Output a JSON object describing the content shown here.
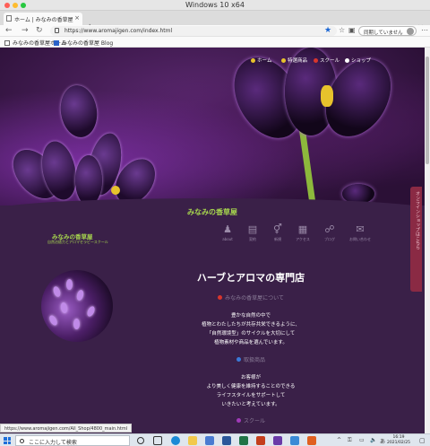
{
  "window": {
    "title": "Windows 10 x64"
  },
  "browser": {
    "tab_title": "ホーム | みなみの香草屋",
    "tab_close": "×",
    "new_tab": "+",
    "window_controls": [
      "—",
      "▢",
      "✕"
    ],
    "url": "https://www.aromajigen.com/index.html",
    "sync_label": "同期していません",
    "bookmarks": [
      {
        "label": "みなみの香草屋ホーム",
        "icon": "page-icon"
      },
      {
        "label": "みなみの香草屋 Blog",
        "icon": "blog-icon"
      }
    ],
    "status_url": "https://www.aromajigen.com/All_Shop/4800_main.html"
  },
  "site": {
    "top_nav": [
      {
        "label": "ホーム",
        "icon": "home-icon",
        "color": "#e7c22c"
      },
      {
        "label": "特選商品",
        "icon": "gift-icon",
        "color": "#e7c22c"
      },
      {
        "label": "スクール",
        "icon": "school-icon",
        "color": "#d8362d"
      },
      {
        "label": "ショップ",
        "icon": "shop-icon",
        "color": "#ffffff"
      }
    ],
    "site_name": "みなみの香草屋",
    "logo_title": "みなみの香草屋",
    "logo_sub": "自然治癒力とアロマセラピースクール",
    "icon_nav": [
      {
        "label": "about",
        "glyph": "♟"
      },
      {
        "label": "契約",
        "glyph": "▤"
      },
      {
        "label": "新規",
        "glyph": "⚥"
      },
      {
        "label": "アクセス",
        "glyph": "▦"
      },
      {
        "label": "ブログ",
        "glyph": "☍"
      },
      {
        "label": "お問い合わせ",
        "glyph": "✉"
      }
    ],
    "side_tab": "オンラインショップはこちら",
    "main_heading": "ハーブとアロマの専門店",
    "sections": [
      {
        "link": "みなみの香草屋について",
        "bullet_color": "#d8362d"
      },
      {
        "link": "取扱商品",
        "bullet_color": "#3a7ad8"
      },
      {
        "link": "スクール",
        "bullet_color": "#a03ab8"
      }
    ],
    "paragraph1": [
      "豊かな自然の中で",
      "植物とわたしたちが共存共栄できるように、",
      "「自然環境型」のサイクルを大切にして",
      "植物素材や商品を選んでいます。"
    ],
    "paragraph2": [
      "お客様が",
      "より美しく健康を維持することのできる",
      "ライフスタイルをサポートして",
      "いきたいと考えています。"
    ]
  },
  "taskbar": {
    "search_placeholder": "ここに入力して検索",
    "clock_time": "16:19",
    "clock_date": "2021/02/25",
    "tray": [
      "^",
      "⚿",
      "▭",
      "🔈",
      "あ"
    ]
  }
}
